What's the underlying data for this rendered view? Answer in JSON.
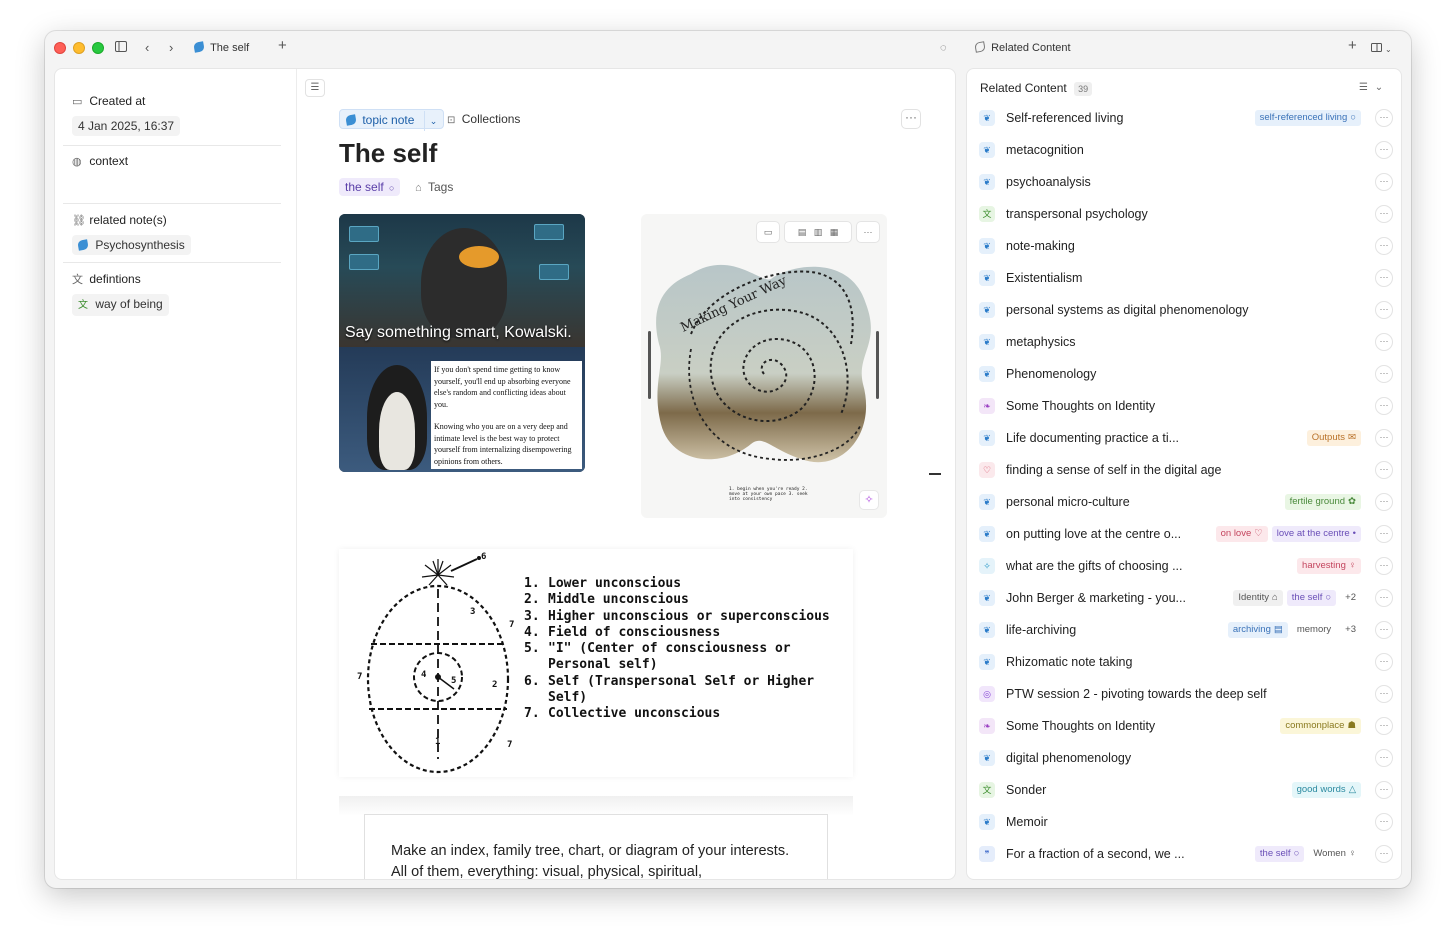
{
  "window": {
    "tab_title": "The self",
    "right_panel_title": "Related Content"
  },
  "properties": {
    "created_label": "Created at",
    "created_value": "4 Jan 2025, 16:37",
    "context_label": "context",
    "related_label": "related note(s)",
    "related_value": "Psychosynthesis",
    "definitions_label": "defintions",
    "definitions_value": "way of being"
  },
  "doc": {
    "type_chip": "topic note",
    "collections_label": "Collections",
    "title": "The self",
    "tag_chip": "the self",
    "tags_label": "Tags",
    "meme_caption": "Say something smart, Kowalski.",
    "meme_text_1": "If you don't spend time getting to know yourself, you'll end up absorbing everyone else's random and conflicting ideas about you.",
    "meme_text_2": "Knowing who you are on a very deep and intimate level is the best way to protect yourself from internalizing disempowering opinions from others.",
    "spiral_text": "Making Your Way",
    "spiral_caption": "1. begin when you're ready 2. move at your own pace 3. seek into consistency",
    "diagram_items": [
      {
        "num": "1.",
        "text": "Lower unconscious"
      },
      {
        "num": "2.",
        "text": "Middle unconscious"
      },
      {
        "num": "3.",
        "text": "Higher unconscious or superconscious"
      },
      {
        "num": "4.",
        "text": "Field of consciousness"
      },
      {
        "num": "5.",
        "text": "\"I\" (Center of consciousness or\nPersonal self)"
      },
      {
        "num": "6.",
        "text": "Self (Transpersonal Self or Higher\nSelf)"
      },
      {
        "num": "7.",
        "text": "Collective unconscious"
      }
    ],
    "quote": "Make an index, family tree, chart, or diagram of your interests. All of them, everything: visual, physical, spiritual,"
  },
  "related": {
    "header": "Related Content",
    "count": "39",
    "items": [
      {
        "title": "Self-referenced living",
        "icon": "topic",
        "tags": [
          {
            "label": "self-referenced living",
            "style": "blue",
            "glyph": "○"
          }
        ]
      },
      {
        "title": "metacognition",
        "icon": "topic",
        "tags": []
      },
      {
        "title": "psychoanalysis",
        "icon": "topic",
        "tags": []
      },
      {
        "title": "transpersonal psychology",
        "icon": "def",
        "tags": []
      },
      {
        "title": "note-making",
        "icon": "topic",
        "tags": []
      },
      {
        "title": "Existentialism",
        "icon": "topic",
        "tags": []
      },
      {
        "title": "personal systems as digital phenomenology",
        "icon": "topic",
        "tags": []
      },
      {
        "title": "metaphysics",
        "icon": "topic",
        "tags": []
      },
      {
        "title": "Phenomenology",
        "icon": "topic",
        "tags": []
      },
      {
        "title": "Some Thoughts on Identity",
        "icon": "think",
        "tags": []
      },
      {
        "title": "Life documenting practice a ti...",
        "icon": "topic",
        "tags": [
          {
            "label": "Outputs",
            "style": "orange",
            "glyph": "✉"
          }
        ]
      },
      {
        "title": "finding a sense of self in the digital age",
        "icon": "heart",
        "tags": []
      },
      {
        "title": "personal micro-culture",
        "icon": "topic",
        "tags": [
          {
            "label": "fertile ground",
            "style": "green",
            "glyph": "✿"
          }
        ]
      },
      {
        "title": "on putting love at the centre o...",
        "icon": "topic",
        "tags": [
          {
            "label": "on love",
            "style": "pink",
            "glyph": "♡"
          },
          {
            "label": "love at the centre",
            "style": "purple",
            "glyph": "•"
          }
        ]
      },
      {
        "title": "what are the gifts of choosing ...",
        "icon": "spark",
        "tags": [
          {
            "label": "harvesting",
            "style": "pink",
            "glyph": "♀"
          }
        ]
      },
      {
        "title": "John Berger & marketing - you...",
        "icon": "topic",
        "tags": [
          {
            "label": "Identity",
            "style": "gray",
            "glyph": "⌂"
          },
          {
            "label": "the self",
            "style": "purple",
            "glyph": "○"
          },
          {
            "label": "+2",
            "style": "plain",
            "glyph": ""
          }
        ]
      },
      {
        "title": "life-archiving",
        "icon": "topic",
        "tags": [
          {
            "label": "archiving",
            "style": "blue",
            "glyph": "▤"
          },
          {
            "label": "memory",
            "style": "plain",
            "glyph": ""
          },
          {
            "label": "+3",
            "style": "plain",
            "glyph": ""
          }
        ]
      },
      {
        "title": "Rhizomatic note taking",
        "icon": "topic",
        "tags": []
      },
      {
        "title": "PTW session 2 - pivoting towards the deep self",
        "icon": "ring",
        "tags": []
      },
      {
        "title": "Some Thoughts on Identity",
        "icon": "think",
        "tags": [
          {
            "label": "commonplace",
            "style": "yellow",
            "glyph": "☗"
          }
        ]
      },
      {
        "title": "digital phenomenology",
        "icon": "topic",
        "tags": []
      },
      {
        "title": "Sonder",
        "icon": "def",
        "tags": [
          {
            "label": "good words",
            "style": "cyan",
            "glyph": "△"
          }
        ]
      },
      {
        "title": "Memoir",
        "icon": "topic",
        "tags": []
      },
      {
        "title": "For a fraction of a second, we ...",
        "icon": "quote",
        "tags": [
          {
            "label": "the self",
            "style": "purple",
            "glyph": "○"
          },
          {
            "label": "Women",
            "style": "plain",
            "glyph": "♀"
          }
        ]
      }
    ]
  }
}
